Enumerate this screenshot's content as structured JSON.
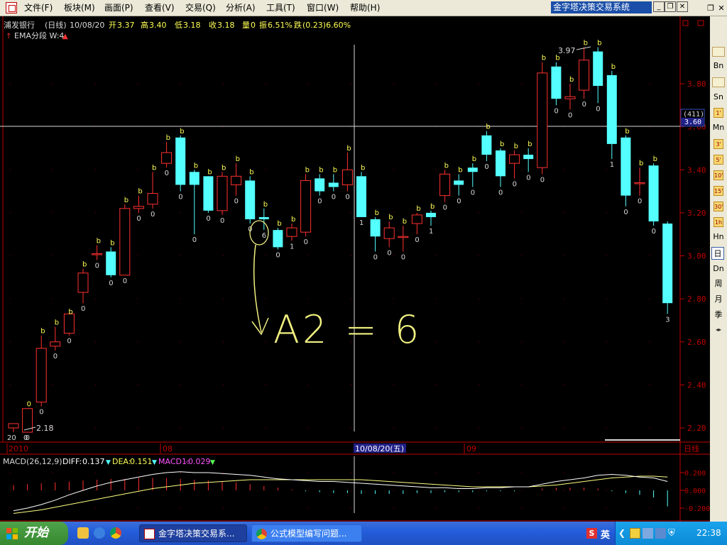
{
  "menubar": {
    "items": [
      "文件(F)",
      "板块(M)",
      "画面(P)",
      "查看(V)",
      "交易(Q)",
      "分析(A)",
      "工具(T)",
      "窗口(W)",
      "帮助(H)"
    ],
    "app_title": "金字塔决策交易系统",
    "win_min": "_",
    "win_restore": "❐",
    "win_close": "✕",
    "mdi_restore": "❐",
    "mdi_close": "✕"
  },
  "info_bar": {
    "name": "浦发银行",
    "period": "(日线)",
    "date": "10/08/20",
    "open_label": "开",
    "open": "3.37",
    "high_label": "高",
    "high": "3.40",
    "low_label": "低",
    "low": "3.18",
    "close_label": "收",
    "close": "3.18",
    "vol_label": "量",
    "vol": "0",
    "amp_label": "振",
    "amp": "6.51%",
    "change_label": "跌",
    "change": "(0.23)6.60%"
  },
  "indicator_line": "EMA分段 W:4",
  "price_axis": {
    "labels": [
      "3.80",
      "3.60",
      "3.40",
      "3.20",
      "3.00",
      "2.80",
      "2.60",
      "2.40",
      "2.20"
    ],
    "cursor_count": "(411)",
    "cursor_price": "3.60"
  },
  "time_axis": {
    "labels": [
      "2010",
      "08",
      "09"
    ],
    "cursor_label": "10/08/20(五)",
    "period_label": "日线"
  },
  "annotations": {
    "high_price": "3.97",
    "low_price": "2.18",
    "first_label": "20",
    "first_label2": "0",
    "circled_digit": "6",
    "handwritten": "A2 = 6"
  },
  "macd": {
    "title": "MACD(26,12,9)",
    "diff_label": "DIFF:",
    "diff": "0.137",
    "dea_label": "DEA:",
    "dea": "0.151",
    "macd_label": "MACD1:",
    "macd": "-0.029",
    "axis_labels": [
      "0.200",
      "0.000",
      "-0.200"
    ]
  },
  "right_toolbar": [
    "Bn",
    "Sn",
    "1'",
    "Mn",
    "3'",
    "5'",
    "10'",
    "15'",
    "30'",
    "1h",
    "Hn",
    "日",
    "Dn",
    "周",
    "月",
    "季"
  ],
  "taskbar": {
    "start": "开始",
    "tasks": [
      "金字塔决策交易系...",
      "公式模型编写问题..."
    ],
    "ime": "英",
    "clock": "22:38"
  },
  "colors": {
    "up_candle": "#ff3030",
    "down_candle": "#54ffff",
    "label_yellow": "#ffff54",
    "axis_red": "#c00000",
    "grid_dot": "#7a0000",
    "handwriting": "#f0f080",
    "dea_line": "#ffff80",
    "diff_line": "#ffffff"
  },
  "chart_data": {
    "type": "candlestick",
    "title": "浦发银行 (日线)",
    "ylim": [
      2.15,
      3.98
    ],
    "candles": [
      {
        "o": 2.2,
        "h": 2.22,
        "l": 2.18,
        "c": 2.22,
        "top": "",
        "bot": "20"
      },
      {
        "o": 2.18,
        "h": 2.29,
        "l": 2.18,
        "c": 2.29,
        "top": "0",
        "bot": "0"
      },
      {
        "o": 2.32,
        "h": 2.63,
        "l": 2.3,
        "c": 2.57,
        "top": "b",
        "bot": "0"
      },
      {
        "o": 2.58,
        "h": 2.67,
        "l": 2.56,
        "c": 2.6,
        "top": "b",
        "bot": "0"
      },
      {
        "o": 2.64,
        "h": 2.72,
        "l": 2.63,
        "c": 2.73,
        "top": "b",
        "bot": "0"
      },
      {
        "o": 2.83,
        "h": 2.94,
        "l": 2.78,
        "c": 2.92,
        "top": "b",
        "bot": "0"
      },
      {
        "o": 3.01,
        "h": 3.05,
        "l": 2.98,
        "c": 3.01,
        "top": "b",
        "bot": "0"
      },
      {
        "o": 3.02,
        "h": 3.04,
        "l": 2.9,
        "c": 2.91,
        "top": "b",
        "bot": "0"
      },
      {
        "o": 2.91,
        "h": 3.24,
        "l": 2.91,
        "c": 3.22,
        "top": "b",
        "bot": "0"
      },
      {
        "o": 3.22,
        "h": 3.28,
        "l": 3.2,
        "c": 3.23,
        "top": "b",
        "bot": "0"
      },
      {
        "o": 3.24,
        "h": 3.39,
        "l": 3.22,
        "c": 3.29,
        "top": "b",
        "bot": "0"
      },
      {
        "o": 3.43,
        "h": 3.53,
        "l": 3.41,
        "c": 3.48,
        "top": "b",
        "bot": "0"
      },
      {
        "o": 3.55,
        "h": 3.56,
        "l": 3.3,
        "c": 3.33,
        "top": "b",
        "bot": "0"
      },
      {
        "o": 3.39,
        "h": 3.4,
        "l": 3.1,
        "c": 3.33,
        "top": "b",
        "bot": "0"
      },
      {
        "o": 3.37,
        "h": 3.37,
        "l": 3.2,
        "c": 3.21,
        "top": "b",
        "bot": "0"
      },
      {
        "o": 3.21,
        "h": 3.39,
        "l": 3.19,
        "c": 3.37,
        "top": "b",
        "bot": "0"
      },
      {
        "o": 3.33,
        "h": 3.43,
        "l": 3.28,
        "c": 3.37,
        "top": "b",
        "bot": "0"
      },
      {
        "o": 3.35,
        "h": 3.37,
        "l": 3.15,
        "c": 3.17,
        "top": "b",
        "bot": "0"
      },
      {
        "o": 3.18,
        "h": 3.22,
        "l": 3.12,
        "c": 3.17,
        "top": "b",
        "bot": "6"
      },
      {
        "o": 3.12,
        "h": 3.13,
        "l": 3.03,
        "c": 3.04,
        "top": "b",
        "bot": "0"
      },
      {
        "o": 3.09,
        "h": 3.15,
        "l": 3.07,
        "c": 3.13,
        "top": "b",
        "bot": "1"
      },
      {
        "o": 3.11,
        "h": 3.38,
        "l": 3.09,
        "c": 3.35,
        "top": "b",
        "bot": "0"
      },
      {
        "o": 3.36,
        "h": 3.38,
        "l": 3.28,
        "c": 3.3,
        "top": "b",
        "bot": "0"
      },
      {
        "o": 3.34,
        "h": 3.38,
        "l": 3.3,
        "c": 3.32,
        "top": "b",
        "bot": "0"
      },
      {
        "o": 3.33,
        "h": 3.48,
        "l": 3.3,
        "c": 3.4,
        "top": "b",
        "bot": "0"
      },
      {
        "o": 3.37,
        "h": 3.39,
        "l": 3.18,
        "c": 3.18,
        "top": "b",
        "bot": "1"
      },
      {
        "o": 3.17,
        "h": 3.18,
        "l": 3.02,
        "c": 3.09,
        "top": "b",
        "bot": "0"
      },
      {
        "o": 3.08,
        "h": 3.16,
        "l": 3.04,
        "c": 3.13,
        "top": "b",
        "bot": "0"
      },
      {
        "o": 3.09,
        "h": 3.14,
        "l": 3.02,
        "c": 3.09,
        "top": "b",
        "bot": "0"
      },
      {
        "o": 3.15,
        "h": 3.2,
        "l": 3.1,
        "c": 3.19,
        "top": "b",
        "bot": "0"
      },
      {
        "o": 3.2,
        "h": 3.21,
        "l": 3.14,
        "c": 3.18,
        "top": "b",
        "bot": "1"
      },
      {
        "o": 3.28,
        "h": 3.4,
        "l": 3.25,
        "c": 3.38,
        "top": "b",
        "bot": "0"
      },
      {
        "o": 3.35,
        "h": 3.38,
        "l": 3.28,
        "c": 3.33,
        "top": "b",
        "bot": "0"
      },
      {
        "o": 3.41,
        "h": 3.43,
        "l": 3.32,
        "c": 3.39,
        "top": "b",
        "bot": "0"
      },
      {
        "o": 3.56,
        "h": 3.58,
        "l": 3.44,
        "c": 3.47,
        "top": "b",
        "bot": "0"
      },
      {
        "o": 3.49,
        "h": 3.5,
        "l": 3.32,
        "c": 3.37,
        "top": "b",
        "bot": "0"
      },
      {
        "o": 3.43,
        "h": 3.49,
        "l": 3.36,
        "c": 3.47,
        "top": "b",
        "bot": "0"
      },
      {
        "o": 3.47,
        "h": 3.5,
        "l": 3.39,
        "c": 3.45,
        "top": "b",
        "bot": "0"
      },
      {
        "o": 3.41,
        "h": 3.9,
        "l": 3.38,
        "c": 3.85,
        "top": "b",
        "bot": "0"
      },
      {
        "o": 3.88,
        "h": 3.9,
        "l": 3.7,
        "c": 3.73,
        "top": "b",
        "bot": "0"
      },
      {
        "o": 3.73,
        "h": 3.8,
        "l": 3.68,
        "c": 3.74,
        "top": "b",
        "bot": "0"
      },
      {
        "o": 3.77,
        "h": 3.97,
        "l": 3.73,
        "c": 3.91,
        "top": "b",
        "bot": "0"
      },
      {
        "o": 3.95,
        "h": 3.97,
        "l": 3.71,
        "c": 3.79,
        "top": "b",
        "bot": "0"
      },
      {
        "o": 3.84,
        "h": 3.86,
        "l": 3.45,
        "c": 3.52,
        "top": "b",
        "bot": "1"
      },
      {
        "o": 3.55,
        "h": 3.56,
        "l": 3.23,
        "c": 3.28,
        "top": "b",
        "bot": "0"
      },
      {
        "o": 3.34,
        "h": 3.41,
        "l": 3.28,
        "c": 3.34,
        "top": "b",
        "bot": "0"
      },
      {
        "o": 3.42,
        "h": 3.43,
        "l": 3.14,
        "c": 3.16,
        "top": "b",
        "bot": "0"
      },
      {
        "o": 3.15,
        "h": 3.16,
        "l": 2.73,
        "c": 2.78,
        "top": "",
        "bot": "3"
      }
    ],
    "macd_hist": [
      0.06,
      0.07,
      0.08,
      0.09,
      0.1,
      0.11,
      0.12,
      0.13,
      0.13,
      0.14,
      0.14,
      0.14,
      0.13,
      0.12,
      0.11,
      0.1,
      0.09,
      0.07,
      0.05,
      0.03,
      0.01,
      -0.01,
      -0.02,
      -0.03,
      -0.03,
      -0.04,
      -0.04,
      -0.04,
      -0.04,
      -0.03,
      -0.03,
      -0.02,
      -0.02,
      -0.02,
      -0.01,
      -0.01,
      -0.01,
      0.0,
      0.02,
      0.03,
      0.03,
      0.03,
      0.02,
      -0.01,
      -0.03,
      -0.05,
      -0.08,
      -0.18
    ],
    "diff": [
      -0.23,
      -0.2,
      -0.16,
      -0.11,
      -0.05,
      0.0,
      0.05,
      0.09,
      0.12,
      0.15,
      0.18,
      0.2,
      0.21,
      0.2,
      0.2,
      0.19,
      0.18,
      0.17,
      0.15,
      0.13,
      0.12,
      0.11,
      0.1,
      0.1,
      0.09,
      0.08,
      0.07,
      0.06,
      0.05,
      0.04,
      0.03,
      0.03,
      0.02,
      0.02,
      0.03,
      0.03,
      0.04,
      0.04,
      0.07,
      0.1,
      0.12,
      0.14,
      0.17,
      0.18,
      0.17,
      0.15,
      0.14,
      0.1
    ],
    "dea": [
      -0.26,
      -0.24,
      -0.22,
      -0.19,
      -0.16,
      -0.13,
      -0.1,
      -0.07,
      -0.04,
      -0.01,
      0.02,
      0.04,
      0.06,
      0.08,
      0.09,
      0.1,
      0.11,
      0.12,
      0.12,
      0.12,
      0.12,
      0.12,
      0.12,
      0.12,
      0.12,
      0.12,
      0.11,
      0.1,
      0.09,
      0.08,
      0.07,
      0.06,
      0.05,
      0.04,
      0.04,
      0.04,
      0.04,
      0.04,
      0.05,
      0.06,
      0.08,
      0.1,
      0.12,
      0.14,
      0.15,
      0.16,
      0.16,
      0.15
    ]
  }
}
